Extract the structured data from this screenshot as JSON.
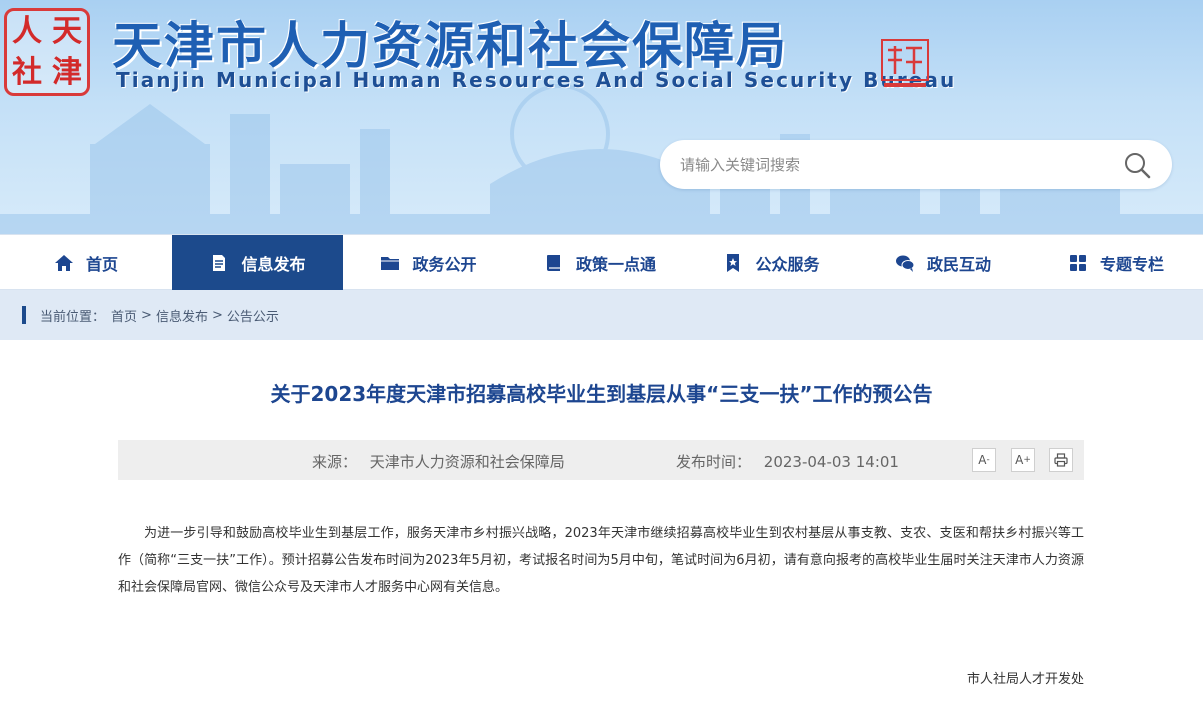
{
  "header": {
    "seal_chars": [
      "人",
      "天",
      "社",
      "津"
    ],
    "title_cn": "天津市人力资源和社会保障局",
    "title_en": "Tianjin Municipal Human Resources And Social Security Bureau",
    "search_placeholder": "请输入关键词搜索"
  },
  "nav": {
    "items": [
      {
        "label": "首页",
        "icon": "home-icon"
      },
      {
        "label": "信息发布",
        "icon": "document-icon",
        "active": true
      },
      {
        "label": "政务公开",
        "icon": "folder-icon"
      },
      {
        "label": "政策一点通",
        "icon": "book-icon"
      },
      {
        "label": "公众服务",
        "icon": "bookmark-icon"
      },
      {
        "label": "政民互动",
        "icon": "chat-icon"
      },
      {
        "label": "专题专栏",
        "icon": "grid-icon"
      }
    ]
  },
  "breadcrumb": {
    "prefix": "当前位置：",
    "items": [
      "首页",
      "信息发布",
      "公告公示"
    ],
    "separator": ">"
  },
  "article": {
    "title": "关于2023年度天津市招募高校毕业生到基层从事“三支一扶”工作的预公告",
    "source_label": "来源：",
    "source": "天津市人力资源和社会保障局",
    "time_label": "发布时间：",
    "time": "2023-04-03 14:01",
    "tools": {
      "font_smaller": "A",
      "font_larger": "A",
      "minus": "-",
      "plus": "+"
    },
    "body": "为进一步引导和鼓励高校毕业生到基层工作，服务天津市乡村振兴战略，2023年天津市继续招募高校毕业生到农村基层从事支教、支农、支医和帮扶乡村振兴等工作（简称“三支一扶”工作）。预计招募公告发布时间为2023年5月初，考试报名时间为5月中旬，笔试时间为6月初，请有意向报考的高校毕业生届时关注天津市人力资源和社会保障局官网、微信公众号及天津市人才服务中心网有关信息。",
    "signature": "市人社局人才开发处"
  },
  "colors": {
    "primary": "#1c4a8c",
    "title_blue": "#1d4690",
    "seal_red": "#d32a2a"
  }
}
